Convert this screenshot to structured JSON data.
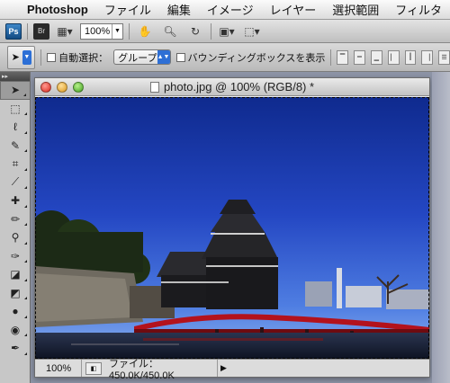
{
  "menubar": {
    "app": "Photoshop",
    "items": [
      "ファイル",
      "編集",
      "イメージ",
      "レイヤー",
      "選択範囲",
      "フィルタ"
    ]
  },
  "appbar": {
    "ps_label": "Ps",
    "br_label": "Br",
    "zoom": "100%"
  },
  "options": {
    "auto_select_label": "自動選択：",
    "auto_select_value": "グループ",
    "bbox_label": "バウンディングボックスを表示"
  },
  "document": {
    "title": "photo.jpg @ 100% (RGB/8) *",
    "status_zoom": "100%",
    "status_info": "ファイル：450.0K/450.0K"
  },
  "icons": [
    "apple-icon",
    "view-extras-icon",
    "hand-icon",
    "zoom-icon",
    "rotate-view-icon",
    "arrange-documents-icon",
    "screen-mode-icon",
    "move-tool-icon",
    "marquee-tool-icon",
    "lasso-tool-icon",
    "quick-selection-icon",
    "crop-tool-icon",
    "eyedropper-icon",
    "healing-brush-icon",
    "brush-tool-icon",
    "clone-stamp-icon",
    "history-brush-icon",
    "eraser-icon",
    "paint-bucket-icon",
    "blur-tool-icon",
    "dodge-tool-icon",
    "pen-tool-icon"
  ]
}
